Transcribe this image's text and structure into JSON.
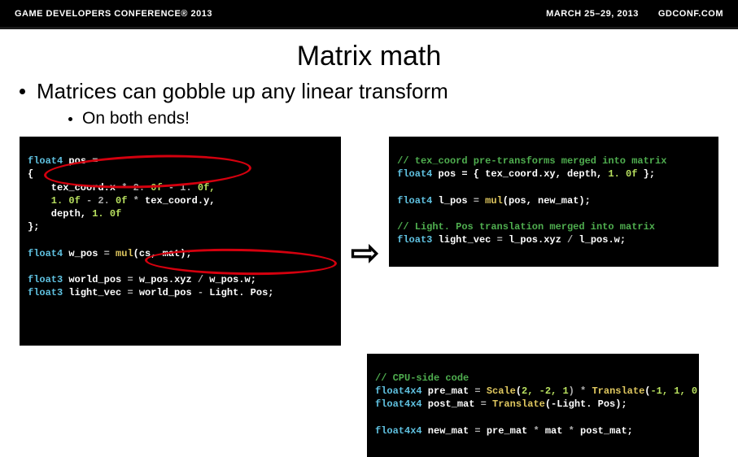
{
  "header": {
    "left": "GAME DEVELOPERS CONFERENCE® 2013",
    "dates": "MARCH 25–29, 2013",
    "site": "GDCONF.COM"
  },
  "title": "Matrix math",
  "bullet1": "Matrices can gobble up any linear transform",
  "bullet2": "On both ends!",
  "code_left": {
    "l1a": "float4",
    "l1b": " pos ",
    "l1c": "=",
    "l2": "{",
    "l3a": "    tex_coord",
    "l3b": ".",
    "l3c": "x ",
    "l3d": "* 2.",
    "l3e": " 0f ",
    "l3f": "- 1.",
    "l3g": " 0f,",
    "l4a": "    1.",
    "l4b": " 0f ",
    "l4c": "- 2.",
    "l4d": " 0f ",
    "l4e": "*",
    "l4f": " tex_coord",
    "l4g": ".",
    "l4h": "y,",
    "l5a": "    depth, ",
    "l5b": "1.",
    "l5c": " 0f",
    "l6": "};",
    "l7": "",
    "l8a": "float4",
    "l8b": " w_pos ",
    "l8c": "=",
    "l8d": " mul",
    "l8e": "(",
    "l8f": "cs, mat",
    "l8g": ");",
    "l9": "",
    "l10a": "float3",
    "l10b": " world_pos ",
    "l10c": "=",
    "l10d": " w_pos",
    "l10e": ".",
    "l10f": "xyz ",
    "l10g": "/",
    "l10h": " w_pos",
    "l10i": ".",
    "l10j": "w;",
    "l11a": "float3",
    "l11b": " light_vec ",
    "l11c": "=",
    "l11d": " world_pos ",
    "l11e": "-",
    "l11f": " Light. Pos;"
  },
  "code_rt": {
    "c1": "// tex_coord pre-transforms merged into matrix",
    "l1a": "float4",
    "l1b": " pos ",
    "l1c": "= {",
    "l1d": " tex_coord",
    "l1e": ".",
    "l1f": "xy, depth, ",
    "l1g": "1.",
    "l1h": " 0f ",
    "l1i": "};",
    "blk": "",
    "l2a": "float4",
    "l2b": " l_pos ",
    "l2c": "=",
    "l2d": " mul",
    "l2e": "(",
    "l2f": "pos, new_mat",
    "l2g": ");",
    "blk2": "",
    "c2": "// Light. Pos translation merged into matrix",
    "l3a": "float3",
    "l3b": " light_vec ",
    "l3c": "=",
    "l3d": " l_pos",
    "l3e": ".",
    "l3f": "xyz ",
    "l3g": "/",
    "l3h": " l_pos",
    "l3i": ".",
    "l3j": "w;"
  },
  "code_rb": {
    "c1": "// CPU-side code",
    "l1a": "float4x4",
    "l1b": " pre_mat ",
    "l1c": "=",
    "l1d": " Scale",
    "l1e": "(",
    "l1f": "2, -2, 1",
    "l1g": ") *",
    "l1h": " Translate",
    "l1i": "(",
    "l1j": "-1, 1, 0",
    "l1k": ");",
    "l2a": "float4x4",
    "l2b": " post_mat ",
    "l2c": "=",
    "l2d": " Translate",
    "l2e": "(",
    "l2f": "-Light. Pos",
    "l2g": ");",
    "blk": "",
    "l3a": "float4x4",
    "l3b": " new_mat ",
    "l3c": "=",
    "l3d": " pre_mat ",
    "l3e": "*",
    "l3f": " mat ",
    "l3g": "*",
    "l3h": " post_mat;"
  },
  "arrow": "⇨"
}
